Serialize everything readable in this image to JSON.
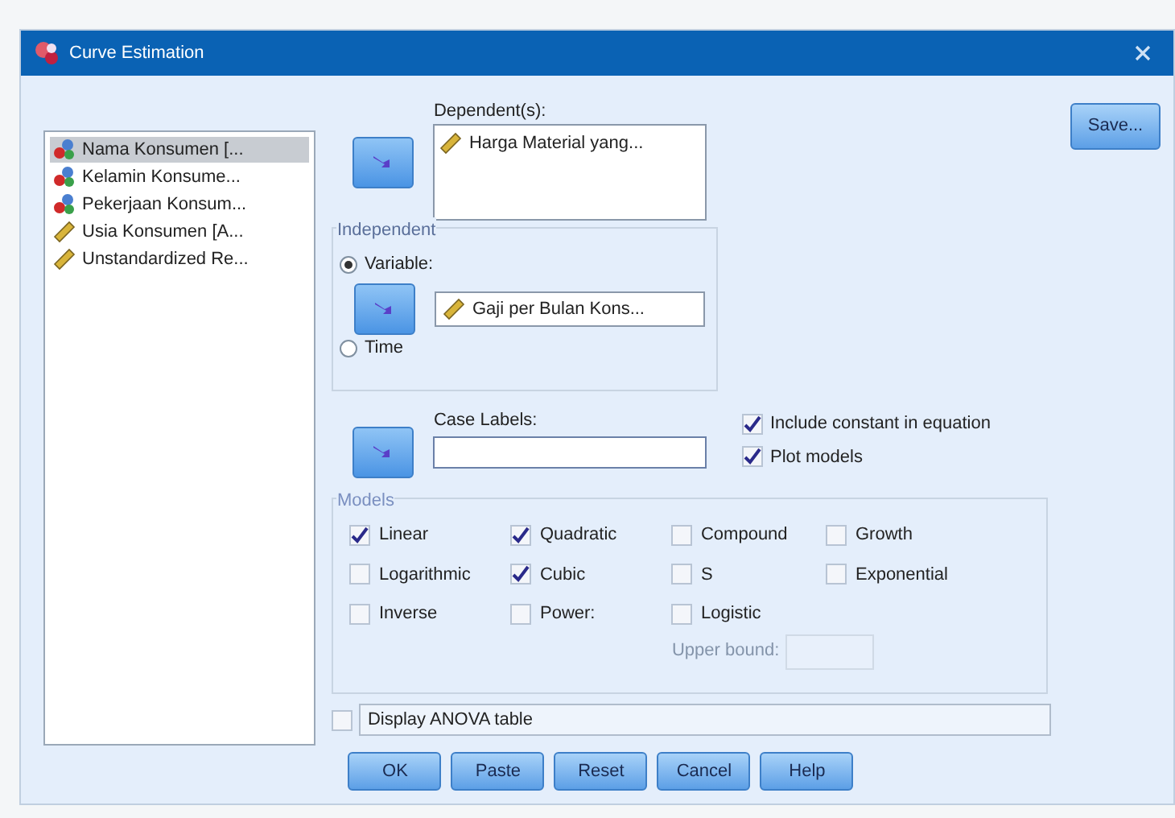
{
  "window": {
    "title": "Curve Estimation"
  },
  "variables": [
    {
      "label": "Nama Konsumen [...",
      "kind": "nominal",
      "selected": true
    },
    {
      "label": "Kelamin Konsume...",
      "kind": "nominal",
      "selected": false
    },
    {
      "label": "Pekerjaan Konsum...",
      "kind": "nominal",
      "selected": false
    },
    {
      "label": "Usia Konsumen [A...",
      "kind": "scale",
      "selected": false
    },
    {
      "label": "Unstandardized Re...",
      "kind": "scale",
      "selected": false
    }
  ],
  "dependent": {
    "label": "Dependent(s):",
    "items": [
      {
        "label": "Harga Material yang...",
        "kind": "scale"
      }
    ]
  },
  "independent": {
    "title": "Independent",
    "options": [
      {
        "label": "Variable:",
        "selected": true
      },
      {
        "label": "Time",
        "selected": false
      }
    ],
    "variable": {
      "label": "Gaji per Bulan Kons...",
      "kind": "scale"
    }
  },
  "case_labels": {
    "label": "Case Labels:"
  },
  "options": [
    {
      "label": "Include constant in equation",
      "checked": true
    },
    {
      "label": "Plot models",
      "checked": true
    }
  ],
  "models": {
    "title": "Models",
    "items": [
      {
        "label": "Linear",
        "checked": true
      },
      {
        "label": "Quadratic",
        "checked": true
      },
      {
        "label": "Compound",
        "checked": false
      },
      {
        "label": "Growth",
        "checked": false
      },
      {
        "label": "Logarithmic",
        "checked": false
      },
      {
        "label": "Cubic",
        "checked": true
      },
      {
        "label": "S",
        "checked": false
      },
      {
        "label": "Exponential",
        "checked": false
      },
      {
        "label": "Inverse",
        "checked": false
      },
      {
        "label": "Power:",
        "checked": false
      },
      {
        "label": "Logistic",
        "checked": false
      }
    ],
    "upper_bound": {
      "label": "Upper bound:",
      "disabled": true
    }
  },
  "anova": {
    "label": "Display ANOVA table",
    "checked": false
  },
  "buttons": [
    "OK",
    "Paste",
    "Reset",
    "Cancel",
    "Help"
  ],
  "save_button": "Save..."
}
